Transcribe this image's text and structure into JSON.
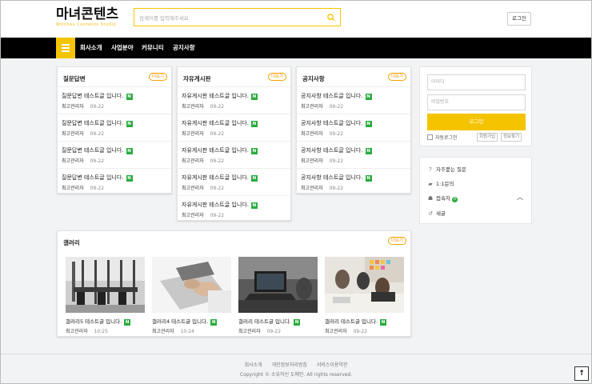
{
  "header": {
    "logo_text": "마녀콘텐츠",
    "logo_sub": "Witches Contents Studio",
    "search_placeholder": "검색어를 입력해주세요",
    "login_label": "로그인"
  },
  "nav": {
    "items": [
      "회사소개",
      "사업분야",
      "커뮤니티",
      "공지사항"
    ]
  },
  "boards": [
    {
      "title": "질문답변",
      "more": "더보기",
      "posts": [
        {
          "title": "질문답변 테스트글 입니다.",
          "author": "최고관리자",
          "date": "09-22"
        },
        {
          "title": "질문답변 테스트글 입니다.",
          "author": "최고관리자",
          "date": "09-22"
        },
        {
          "title": "질문답변 테스트글 입니다.",
          "author": "최고관리자",
          "date": "09-22"
        },
        {
          "title": "질문답변 테스트글 입니다.",
          "author": "최고관리자",
          "date": "09-22"
        }
      ]
    },
    {
      "title": "자유게시판",
      "more": "더보기",
      "posts": [
        {
          "title": "자유게시판 테스트글 입니다.",
          "author": "최고관리자",
          "date": "09-22"
        },
        {
          "title": "자유게시판 테스트글 입니다.",
          "author": "최고관리자",
          "date": "09-22"
        },
        {
          "title": "자유게시판 테스트글 입니다.",
          "author": "최고관리자",
          "date": "09-22"
        },
        {
          "title": "자유게시판 테스트글 입니다.",
          "author": "최고관리자",
          "date": "09-22"
        },
        {
          "title": "자유게시판 테스트글 입니다.",
          "author": "최고관리자",
          "date": "09-22"
        }
      ]
    },
    {
      "title": "공지사항",
      "more": "더보기",
      "posts": [
        {
          "title": "공지사항 테스트글 입니다.",
          "author": "최고관리자",
          "date": "09-22"
        },
        {
          "title": "공지사항 테스트글 입니다.",
          "author": "최고관리자",
          "date": "09-22"
        },
        {
          "title": "공지사항 테스트글 입니다.",
          "author": "최고관리자",
          "date": "09-22"
        },
        {
          "title": "공지사항 테스트글 입니다.",
          "author": "최고관리자",
          "date": "09-22"
        }
      ]
    }
  ],
  "new_badge": "N",
  "gallery": {
    "title": "갤러리",
    "more": "더보기",
    "items": [
      {
        "title": "갤러리5 테스트글 입니다.",
        "author": "최고관리자",
        "date": "10:25"
      },
      {
        "title": "갤러리4 테스트글 입니다.",
        "author": "최고관리자",
        "date": "10:24"
      },
      {
        "title": "갤러리 테스트글 입니다.",
        "author": "최고관리자",
        "date": "09-22"
      },
      {
        "title": "갤러리 테스트글 입니다.",
        "author": "최고관리자",
        "date": "09-22"
      }
    ]
  },
  "sidebar": {
    "id_placeholder": "아이디",
    "pw_placeholder": "비밀번호",
    "login_submit": "로그인",
    "auto_login": "자동로그인",
    "signup": "회원가입",
    "find_info": "정보찾기",
    "menu": [
      {
        "label": "자주묻는 질문",
        "icon": "question-circle-icon"
      },
      {
        "label": "1:1문의",
        "icon": "chat-bubbles-icon"
      },
      {
        "label": "접속자",
        "icon": "users-icon",
        "count": "0"
      },
      {
        "label": "새글",
        "icon": "refresh-icon"
      }
    ]
  },
  "footer": {
    "links": [
      "회사소개",
      "개인정보처리방침",
      "서비스이용약관"
    ],
    "copyright": "Copyright © 소유하신 도메인. All rights reserved.",
    "top_label": "↑"
  },
  "colors": {
    "accent": "#f5c400",
    "nav_bg": "#000000",
    "badge_green": "#2aab3e",
    "more_orange": "#f59300"
  }
}
